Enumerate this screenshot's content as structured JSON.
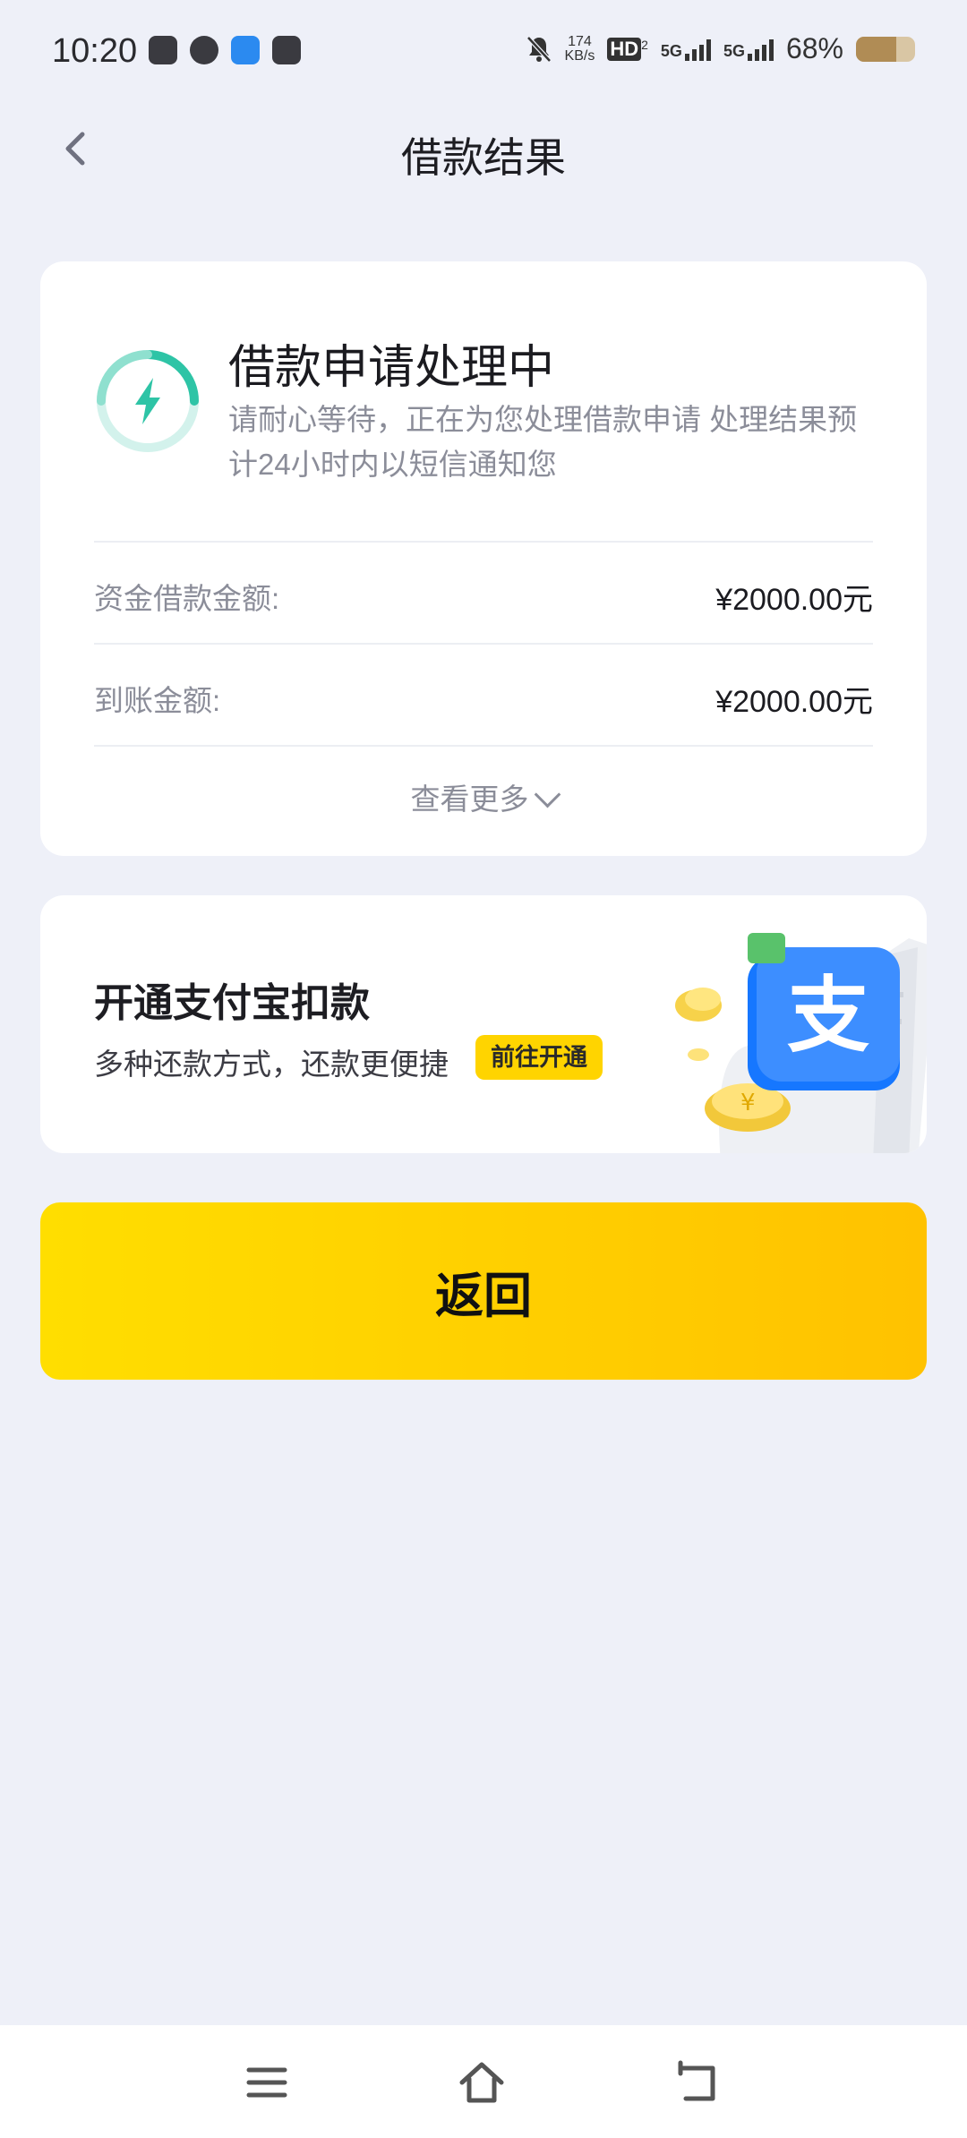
{
  "status_bar": {
    "time": "10:20",
    "net_speed_value": "174",
    "net_speed_unit": "KB/s",
    "hd": "HD",
    "hd_sub": "2",
    "sim1": "5G",
    "sim2": "5G",
    "battery": "68%",
    "battery_level": 0.68
  },
  "nav": {
    "title": "借款结果"
  },
  "status": {
    "title": "借款申请处理中",
    "description": "请耐心等待，正在为您处理借款申请 处理结果预计24小时内以短信通知您",
    "accent": "#2ec4a6"
  },
  "details": [
    {
      "label": "资金借款金额:",
      "value": "¥2000.00元"
    },
    {
      "label": "到账金额:",
      "value": "¥2000.00元"
    }
  ],
  "more": {
    "label": "查看更多"
  },
  "promo": {
    "title": "开通支付宝扣款",
    "subtitle": "多种还款方式，还款更便捷",
    "button": "前往开通",
    "logo_char": "支"
  },
  "return_button": {
    "label": "返回",
    "color_start": "#ffde00",
    "color_end": "#ffc200"
  },
  "bottom_nav": [
    "menu-icon",
    "home-icon",
    "back-icon"
  ]
}
